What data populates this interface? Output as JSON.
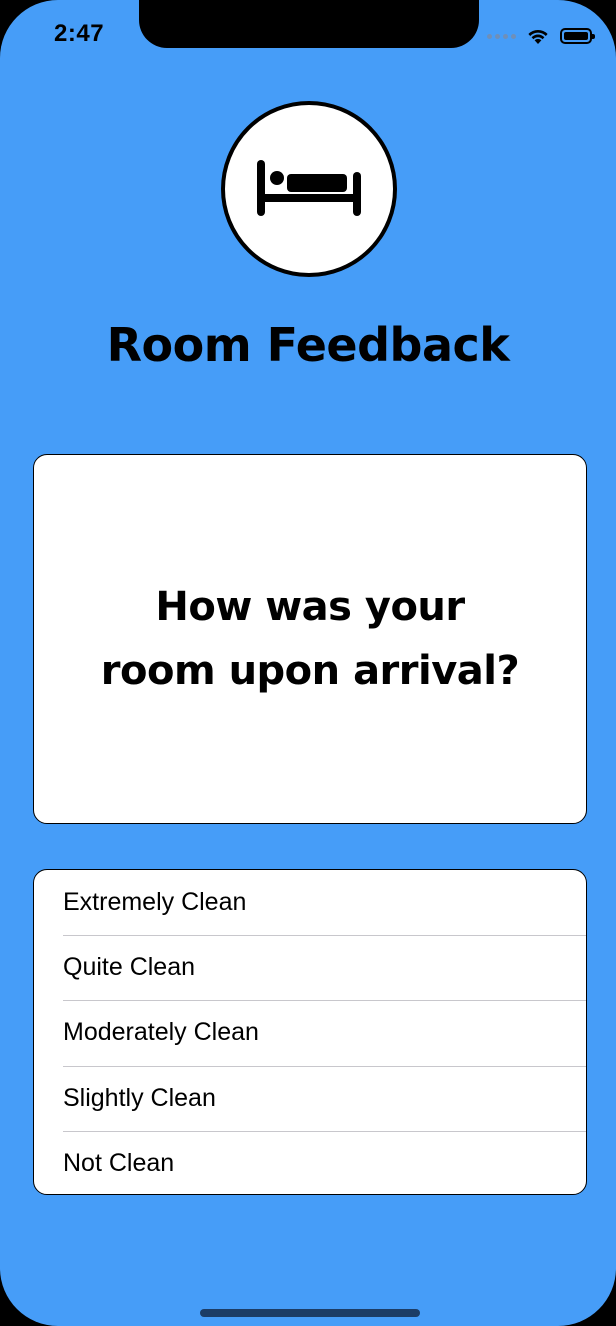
{
  "status_bar": {
    "time": "2:47"
  },
  "header": {
    "icon": "bed-icon",
    "title": "Room Feedback"
  },
  "question": {
    "text": "How was your room upon arrival?"
  },
  "options": [
    {
      "label": "Extremely Clean"
    },
    {
      "label": "Quite Clean"
    },
    {
      "label": "Moderately Clean"
    },
    {
      "label": "Slightly Clean"
    },
    {
      "label": "Not Clean"
    }
  ],
  "colors": {
    "background": "#469DF8",
    "card": "#FFFFFF",
    "text": "#000000"
  }
}
